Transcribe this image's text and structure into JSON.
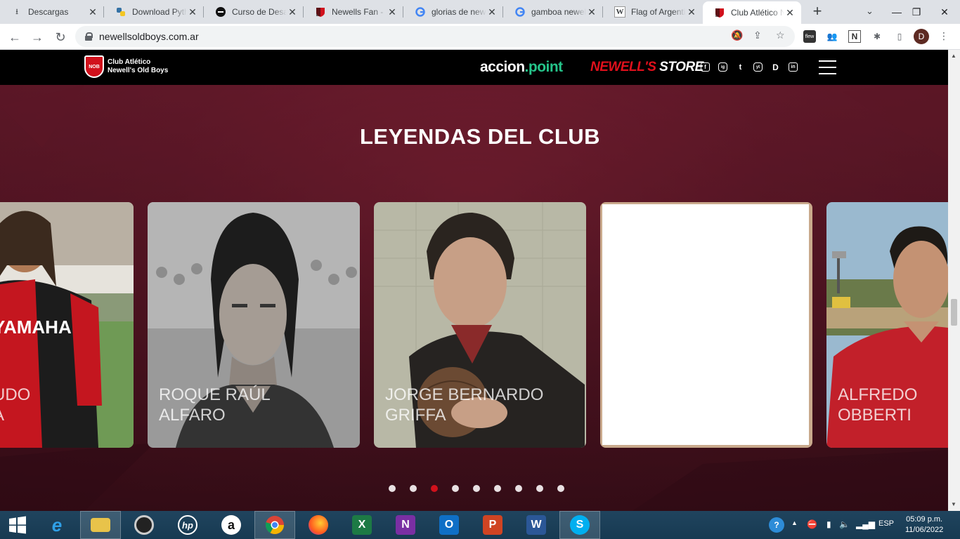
{
  "browser": {
    "tabs": [
      {
        "title": "Descargas",
        "icon": "download-icon"
      },
      {
        "title": "Download Python",
        "icon": "python-icon"
      },
      {
        "title": "Curso de Desarrollo",
        "icon": "course-icon"
      },
      {
        "title": "Newells Fan - I",
        "icon": "newells-icon"
      },
      {
        "title": "glorias de newells",
        "icon": "google-icon"
      },
      {
        "title": "gamboa newells",
        "icon": "google-icon"
      },
      {
        "title": "Flag of Argentina",
        "icon": "wikipedia-icon"
      },
      {
        "title": "Club Atlético N",
        "icon": "newells-icon",
        "active": true
      }
    ],
    "url": "newellsoldboys.com.ar",
    "profile_initial": "D"
  },
  "site": {
    "logo_badge": "NOB",
    "logo_line1": "Club Atlético",
    "logo_line2": "Newell's Old Boys",
    "partner_accion": "accion",
    "partner_point": ".point",
    "store_brand": "NEWELL'S",
    "store_word": " STORE",
    "social": [
      "f",
      "ig",
      "t",
      "yt",
      "D",
      "in"
    ]
  },
  "section": {
    "title_bold": "LEYENDAS",
    "title_rest": " DEL CLUB"
  },
  "legends": [
    {
      "line1": "UDO",
      "line2": "A"
    },
    {
      "line1": "ROQUE RAÚL",
      "line2": "ALFARO"
    },
    {
      "line1": "JORGE BERNARDO",
      "line2": "GRIFFA"
    },
    {
      "line1": "",
      "line2": ""
    },
    {
      "line1": "ALFREDO",
      "line2": "OBBERTI"
    }
  ],
  "carousel": {
    "pages": 9,
    "active_index": 2
  },
  "taskbar": {
    "lang": "ESP",
    "time": "05:09 p.m.",
    "date": "11/06/2022"
  },
  "colors": {
    "brand_red": "#d1111c",
    "bg_maroon": "#4a1220",
    "accion_green": "#25c48a"
  }
}
